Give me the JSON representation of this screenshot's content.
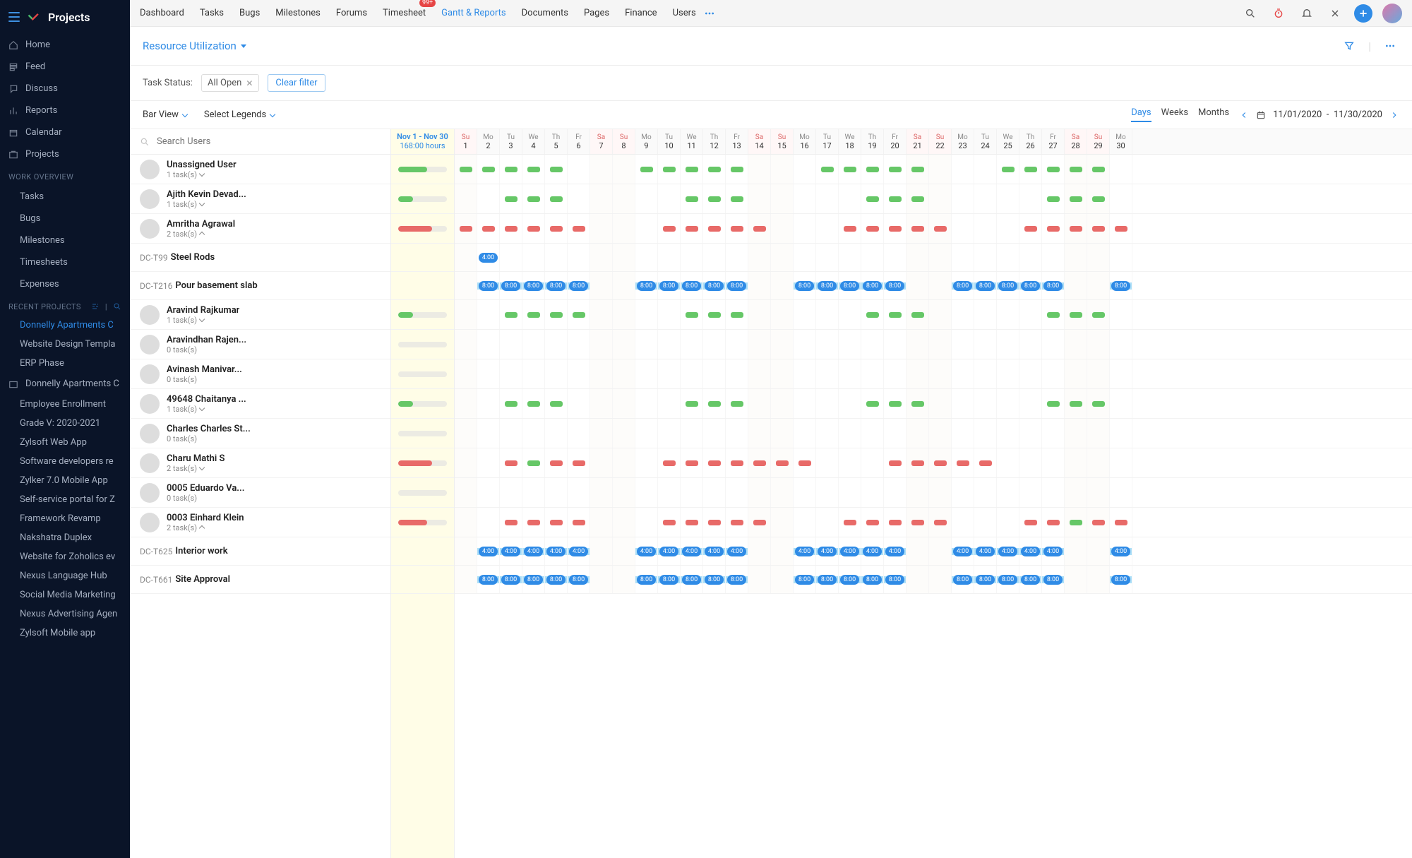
{
  "brand": "Projects",
  "sidebar": {
    "primary": [
      {
        "label": "Home",
        "icon": "home"
      },
      {
        "label": "Feed",
        "icon": "feed"
      },
      {
        "label": "Discuss",
        "icon": "discuss"
      },
      {
        "label": "Reports",
        "icon": "reports"
      },
      {
        "label": "Calendar",
        "icon": "calendar"
      },
      {
        "label": "Projects",
        "icon": "projects"
      }
    ],
    "work_overview_header": "WORK OVERVIEW",
    "work_overview": [
      "Tasks",
      "Bugs",
      "Milestones",
      "Timesheets",
      "Expenses"
    ],
    "recent_header": "RECENT PROJECTS",
    "recent": [
      {
        "label": "Donnelly Apartments C",
        "active": true
      },
      {
        "label": "Website Design Templa"
      },
      {
        "label": "ERP Phase"
      },
      {
        "label": "Donnelly Apartments C",
        "has_icon": true
      },
      {
        "label": "Employee Enrollment"
      },
      {
        "label": "Grade V: 2020-2021"
      },
      {
        "label": "Zylsoft Web App"
      },
      {
        "label": "Software developers re"
      },
      {
        "label": "Zylker 7.0 Mobile App"
      },
      {
        "label": "Self-service portal for Z"
      },
      {
        "label": "Framework Revamp"
      },
      {
        "label": "Nakshatra Duplex"
      },
      {
        "label": "Website for Zoholics ev"
      },
      {
        "label": "Nexus Language Hub"
      },
      {
        "label": "Social Media Marketing"
      },
      {
        "label": "Nexus Advertising Agen"
      },
      {
        "label": "Zylsoft Mobile app"
      }
    ]
  },
  "topbar": {
    "tabs": [
      {
        "label": "Dashboard"
      },
      {
        "label": "Tasks"
      },
      {
        "label": "Bugs"
      },
      {
        "label": "Milestones"
      },
      {
        "label": "Forums"
      },
      {
        "label": "Timesheet",
        "badge": "99+"
      },
      {
        "label": "Gantt & Reports",
        "active": true
      },
      {
        "label": "Documents"
      },
      {
        "label": "Pages"
      },
      {
        "label": "Finance"
      },
      {
        "label": "Users"
      }
    ]
  },
  "page_title": "Resource Utilization",
  "filter": {
    "label": "Task Status:",
    "value": "All Open",
    "clear": "Clear filter"
  },
  "view": {
    "bar_view": "Bar View",
    "legends": "Select Legends",
    "scales": [
      "Days",
      "Weeks",
      "Months"
    ],
    "active_scale": "Days",
    "date_range": "11/01/2020",
    "date_range_sep": "-",
    "date_range_end": "11/30/2020"
  },
  "search_placeholder": "Search Users",
  "summary": {
    "range": "Nov 1 - Nov 30",
    "hours": "168:00 hours"
  },
  "calendar": [
    {
      "dow": "Su",
      "num": 1,
      "weekend": true
    },
    {
      "dow": "Mo",
      "num": 2
    },
    {
      "dow": "Tu",
      "num": 3
    },
    {
      "dow": "We",
      "num": 4
    },
    {
      "dow": "Th",
      "num": 5
    },
    {
      "dow": "Fr",
      "num": 6
    },
    {
      "dow": "Sa",
      "num": 7,
      "weekend": true
    },
    {
      "dow": "Su",
      "num": 8,
      "weekend": true
    },
    {
      "dow": "Mo",
      "num": 9
    },
    {
      "dow": "Tu",
      "num": 10
    },
    {
      "dow": "We",
      "num": 11
    },
    {
      "dow": "Th",
      "num": 12
    },
    {
      "dow": "Fr",
      "num": 13
    },
    {
      "dow": "Sa",
      "num": 14,
      "weekend": true
    },
    {
      "dow": "Su",
      "num": 15,
      "weekend": true
    },
    {
      "dow": "Mo",
      "num": 16
    },
    {
      "dow": "Tu",
      "num": 17
    },
    {
      "dow": "We",
      "num": 18
    },
    {
      "dow": "Th",
      "num": 19
    },
    {
      "dow": "Fr",
      "num": 20
    },
    {
      "dow": "Sa",
      "num": 21,
      "weekend": true
    },
    {
      "dow": "Su",
      "num": 22,
      "weekend": true
    },
    {
      "dow": "Mo",
      "num": 23
    },
    {
      "dow": "Tu",
      "num": 24
    },
    {
      "dow": "We",
      "num": 25
    },
    {
      "dow": "Th",
      "num": 26
    },
    {
      "dow": "Fr",
      "num": 27
    },
    {
      "dow": "Sa",
      "num": 28,
      "weekend": true
    },
    {
      "dow": "Su",
      "num": 29,
      "weekend": true
    },
    {
      "dow": "Mo",
      "num": 30
    }
  ],
  "rows": [
    {
      "type": "user",
      "name": "Unassigned User",
      "sub": "1 task(s)",
      "expand": "down",
      "sum_color": "#66c767",
      "sum_pct": 60,
      "cells": "GGGGGWW.GGGGGWW.GGGGGWW.GGGGGWW..",
      "color": "green"
    },
    {
      "type": "user",
      "name": "Ajith Kevin Devad...",
      "sub": "1 task(s)",
      "expand": "down",
      "sum_color": "#66c767",
      "sum_pct": 30,
      "cells": "..GGG.WW..GGG.WW..GGG.WW..GGG.WW..G",
      "color": "green"
    },
    {
      "type": "user",
      "name": "Amritha Agrawal",
      "sub": "2 task(s)",
      "expand": "up",
      "sum_color": "#e86a68",
      "sum_pct": 70,
      "cells": "RRRRRRWW.RRRRRWW.RRRRRWW.RRRRRWW.R",
      "color": "red"
    },
    {
      "type": "task",
      "code": "DC-T99",
      "label": "Steel Rods",
      "bar_start": 0,
      "bar_end": 1,
      "pill": "4:00"
    },
    {
      "type": "task",
      "code": "DC-T216",
      "label": "Pour basement slab",
      "bar_start": 0,
      "bar_end": 30,
      "pill_every": "8:00"
    },
    {
      "type": "user",
      "name": "Aravind Rajkumar",
      "sub": "1 task(s)",
      "expand": "down",
      "sum_color": "#66c767",
      "sum_pct": 30,
      "cells": "..GGGGWW..GGG.WW..GGG.WW..GGG.WW..",
      "color": "green"
    },
    {
      "type": "user",
      "name": "Aravindhan Rajen...",
      "sub": "0 task(s)",
      "sum_color": "#ecebe3",
      "sum_pct": 0,
      "cells": ""
    },
    {
      "type": "user",
      "name": "Avinash Manivar...",
      "sub": "0 task(s)",
      "sum_color": "#ecebe3",
      "sum_pct": 0,
      "cells": ""
    },
    {
      "type": "user",
      "name": "49648 Chaitanya ...",
      "sub": "1 task(s)",
      "expand": "down",
      "sum_color": "#66c767",
      "sum_pct": 30,
      "cells": "..GGG.WW..GGG.WW..GGG.WW..GGG.WW.",
      "color": "green"
    },
    {
      "type": "user",
      "name": "Charles Charles St...",
      "sub": "0 task(s)",
      "sum_color": "#ecebe3",
      "sum_pct": 0,
      "cells": ""
    },
    {
      "type": "user",
      "name": "Charu Mathi S",
      "sub": "2 task(s)",
      "expand": "down",
      "sum_color": "#e86a68",
      "sum_pct": 70,
      "cells": "..RGRRWW.RRRRRRRWW.RRRRRWW........",
      "color": "red"
    },
    {
      "type": "user",
      "name": "0005 Eduardo Va...",
      "sub": "0 task(s)",
      "sum_color": "#ecebe3",
      "sum_pct": 0,
      "cells": ""
    },
    {
      "type": "user",
      "name": "0003 Einhard Klein",
      "sub": "2 task(s)",
      "expand": "up",
      "sum_color": "#e86a68",
      "sum_pct": 60,
      "cells": "..RRRRWW.RRRRRWW.RRRRRWW.RRGRRWW.",
      "color": "red"
    },
    {
      "type": "task",
      "code": "DC-T625",
      "label": "Interior work",
      "bar_start": 0,
      "bar_end": 30,
      "pill_every": "4:00"
    },
    {
      "type": "task",
      "code": "DC-T661",
      "label": "Site Approval",
      "bar_start": 0,
      "bar_end": 30,
      "pill_every": "8:00"
    }
  ]
}
